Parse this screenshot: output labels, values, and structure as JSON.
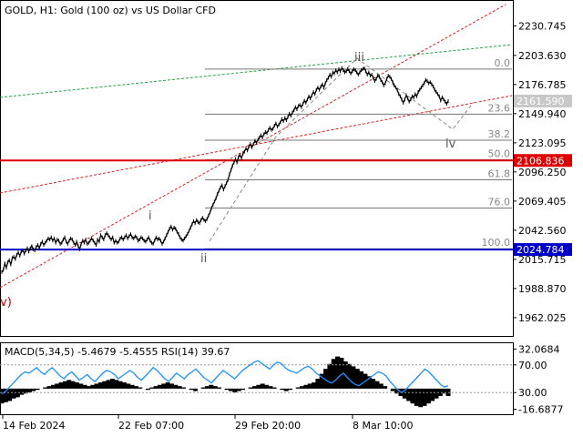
{
  "header": {
    "symbol_line": "GOLD, H1:  Gold (100 oz) vs US Dollar CFD"
  },
  "chart_data": [
    {
      "type": "line",
      "name": "price",
      "ylim": [
        1946,
        2253
      ],
      "y_ticks": [
        "2230.745",
        "2203.630",
        "2176.785",
        "2149.940",
        "2123.095",
        "2096.250",
        "2069.405",
        "2042.560",
        "2015.715",
        "1988.870",
        "1962.025"
      ],
      "price_tags": [
        {
          "label": "2161.590",
          "value": 2161.59,
          "color": "#c8c8c8"
        },
        {
          "label": "2106.836",
          "value": 2106.836,
          "color": "#dc0000"
        },
        {
          "label": "2024.784",
          "value": 2024.784,
          "color": "#0000c8"
        }
      ],
      "fib_levels": [
        {
          "label": "0.0",
          "value": 2191.0
        },
        {
          "label": "23.6",
          "value": 2149.5
        },
        {
          "label": "38.2",
          "value": 2125.5
        },
        {
          "label": "50.0",
          "value": 2107.5
        },
        {
          "label": "61.8",
          "value": 2089.0
        },
        {
          "label": "76.0",
          "value": 2063.0
        },
        {
          "label": "100.0",
          "value": 2025.5
        }
      ],
      "wave_labels": [
        {
          "label": "v)",
          "color": "#cc0000"
        },
        {
          "label": "i",
          "color": "#555555"
        },
        {
          "label": "ii",
          "color": "#555555"
        },
        {
          "label": "iii",
          "color": "#555555"
        },
        {
          "label": "iv",
          "color": "#555555"
        }
      ],
      "x_labels": [
        "14 Feb 2024",
        "22 Feb 07:00",
        "29 Feb 20:00",
        "8 Mar 10:00"
      ],
      "series": [
        {
          "values": [
            2004,
            2006,
            2012,
            2008,
            2013,
            2015,
            2011,
            2017,
            2018,
            2016,
            2020,
            2022,
            2019,
            2023,
            2024,
            2021,
            2024,
            2026,
            2023,
            2026,
            2028,
            2025,
            2024,
            2027,
            2029,
            2026,
            2030,
            2032,
            2029,
            2031,
            2033,
            2035,
            2034,
            2036,
            2033,
            2035,
            2031,
            2034,
            2033,
            2030,
            2031,
            2034,
            2036,
            2032,
            2030,
            2033,
            2035,
            2034,
            2031,
            2029,
            2032,
            2028,
            2025,
            2030,
            2033,
            2031,
            2034,
            2030,
            2031,
            2033,
            2035,
            2033,
            2031,
            2029,
            2034,
            2032,
            2038,
            2036,
            2034,
            2038,
            2040,
            2038,
            2036,
            2034,
            2036,
            2031,
            2033,
            2031,
            2032,
            2035,
            2036,
            2034,
            2036,
            2038,
            2035,
            2037,
            2039,
            2036,
            2035,
            2037,
            2036,
            2033,
            2034,
            2036,
            2035,
            2033,
            2032,
            2034,
            2036,
            2033,
            2031,
            2030,
            2033,
            2036,
            2034,
            2035,
            2033,
            2030,
            2032,
            2035,
            2038,
            2041,
            2044,
            2046,
            2043,
            2045,
            2044,
            2041,
            2039,
            2036,
            2034,
            2033,
            2035,
            2037,
            2039,
            2042,
            2045,
            2048,
            2051,
            2049,
            2052,
            2050,
            2049,
            2052,
            2054,
            2052,
            2051,
            2053,
            2056,
            2059,
            2063,
            2066,
            2069,
            2072,
            2076,
            2079,
            2082,
            2084,
            2080,
            2083,
            2086,
            2089,
            2094,
            2098,
            2102,
            2105,
            2108,
            2105,
            2110,
            2112,
            2109,
            2113,
            2115,
            2118,
            2116,
            2120,
            2122,
            2119,
            2122,
            2125,
            2123,
            2126,
            2128,
            2130,
            2128,
            2131,
            2133,
            2132,
            2135,
            2137,
            2135,
            2136,
            2139,
            2141,
            2138,
            2140,
            2142,
            2145,
            2143,
            2146,
            2144,
            2147,
            2150,
            2148,
            2151,
            2153,
            2156,
            2154,
            2157,
            2158,
            2156,
            2159,
            2162,
            2160,
            2163,
            2166,
            2164,
            2167,
            2170,
            2168,
            2172,
            2174,
            2172,
            2175,
            2177,
            2174,
            2178,
            2181,
            2183,
            2186,
            2184,
            2188,
            2187,
            2190,
            2188,
            2191,
            2189,
            2192,
            2190,
            2188,
            2189,
            2191,
            2189,
            2187,
            2189,
            2191,
            2190,
            2188,
            2186,
            2188,
            2190,
            2191,
            2192,
            2189,
            2186,
            2188,
            2185,
            2186,
            2183,
            2180,
            2182,
            2185,
            2184,
            2181,
            2179,
            2176,
            2178,
            2182,
            2185,
            2184,
            2182,
            2179,
            2176,
            2174,
            2172,
            2168,
            2166,
            2163,
            2160,
            2163,
            2167,
            2164,
            2161,
            2163,
            2166,
            2165,
            2168,
            2166,
            2170,
            2172,
            2174,
            2176,
            2178,
            2181,
            2180,
            2178,
            2179,
            2177,
            2175,
            2172,
            2170,
            2168,
            2166,
            2162,
            2165,
            2163,
            2161,
            2159,
            2161.59
          ]
        }
      ]
    },
    {
      "type": "line",
      "indicator_label": "MACD(5,34,5) -5.4679 -5.4555 RSI(14) 39.67",
      "ylim": [
        -20,
        36
      ],
      "y_ticks": [
        "32.0684",
        "70.00",
        "30.00",
        "-16.6877"
      ],
      "series": [
        {
          "name": "MACD",
          "color": "#000000",
          "values": [
            -12,
            -11,
            -10,
            -8,
            -7,
            -5,
            -4,
            -3,
            -2,
            -1,
            0,
            1,
            2,
            3,
            4,
            5,
            6,
            7,
            6,
            5,
            4,
            3,
            2,
            3,
            4,
            5,
            6,
            7,
            8,
            7,
            6,
            5,
            4,
            3,
            2,
            1,
            0,
            -1,
            1,
            2,
            3,
            4,
            5,
            4,
            3,
            2,
            1,
            0,
            -1,
            -2,
            0,
            1,
            2,
            3,
            2,
            1,
            0,
            -1,
            -2,
            -3,
            -2,
            -1,
            0,
            1,
            2,
            3,
            4,
            3,
            2,
            1,
            0,
            -1,
            -2,
            -1,
            0,
            1,
            2,
            3,
            4,
            5,
            8,
            12,
            16,
            20,
            24,
            26,
            25,
            22,
            20,
            18,
            16,
            14,
            12,
            10,
            8,
            6,
            4,
            2,
            0,
            -2,
            -4,
            -6,
            -8,
            -10,
            -12,
            -14,
            -15,
            -14,
            -12,
            -10,
            -8,
            -6,
            -4,
            -6
          ]
        },
        {
          "name": "RSI(14)",
          "color": "#1e90ff",
          "values": [
            28,
            32,
            38,
            44,
            50,
            56,
            60,
            58,
            62,
            66,
            60,
            56,
            62,
            66,
            60,
            54,
            50,
            56,
            60,
            54,
            48,
            52,
            56,
            50,
            46,
            52,
            58,
            62,
            60,
            56,
            50,
            54,
            58,
            62,
            58,
            52,
            48,
            54,
            60,
            66,
            62,
            56,
            50,
            46,
            52,
            58,
            54,
            50,
            56,
            60,
            64,
            58,
            52,
            48,
            44,
            50,
            56,
            62,
            58,
            54,
            50,
            56,
            62,
            66,
            70,
            74,
            76,
            72,
            68,
            64,
            70,
            74,
            72,
            66,
            62,
            60,
            58,
            62,
            66,
            68,
            64,
            58,
            54,
            50,
            46,
            44,
            48,
            54,
            58,
            52,
            46,
            42,
            40,
            44,
            48,
            52,
            56,
            60,
            58,
            54,
            46,
            40,
            34,
            30,
            34,
            40,
            46,
            52,
            58,
            64,
            60,
            54,
            48,
            42,
            38,
            40
          ]
        }
      ]
    }
  ]
}
